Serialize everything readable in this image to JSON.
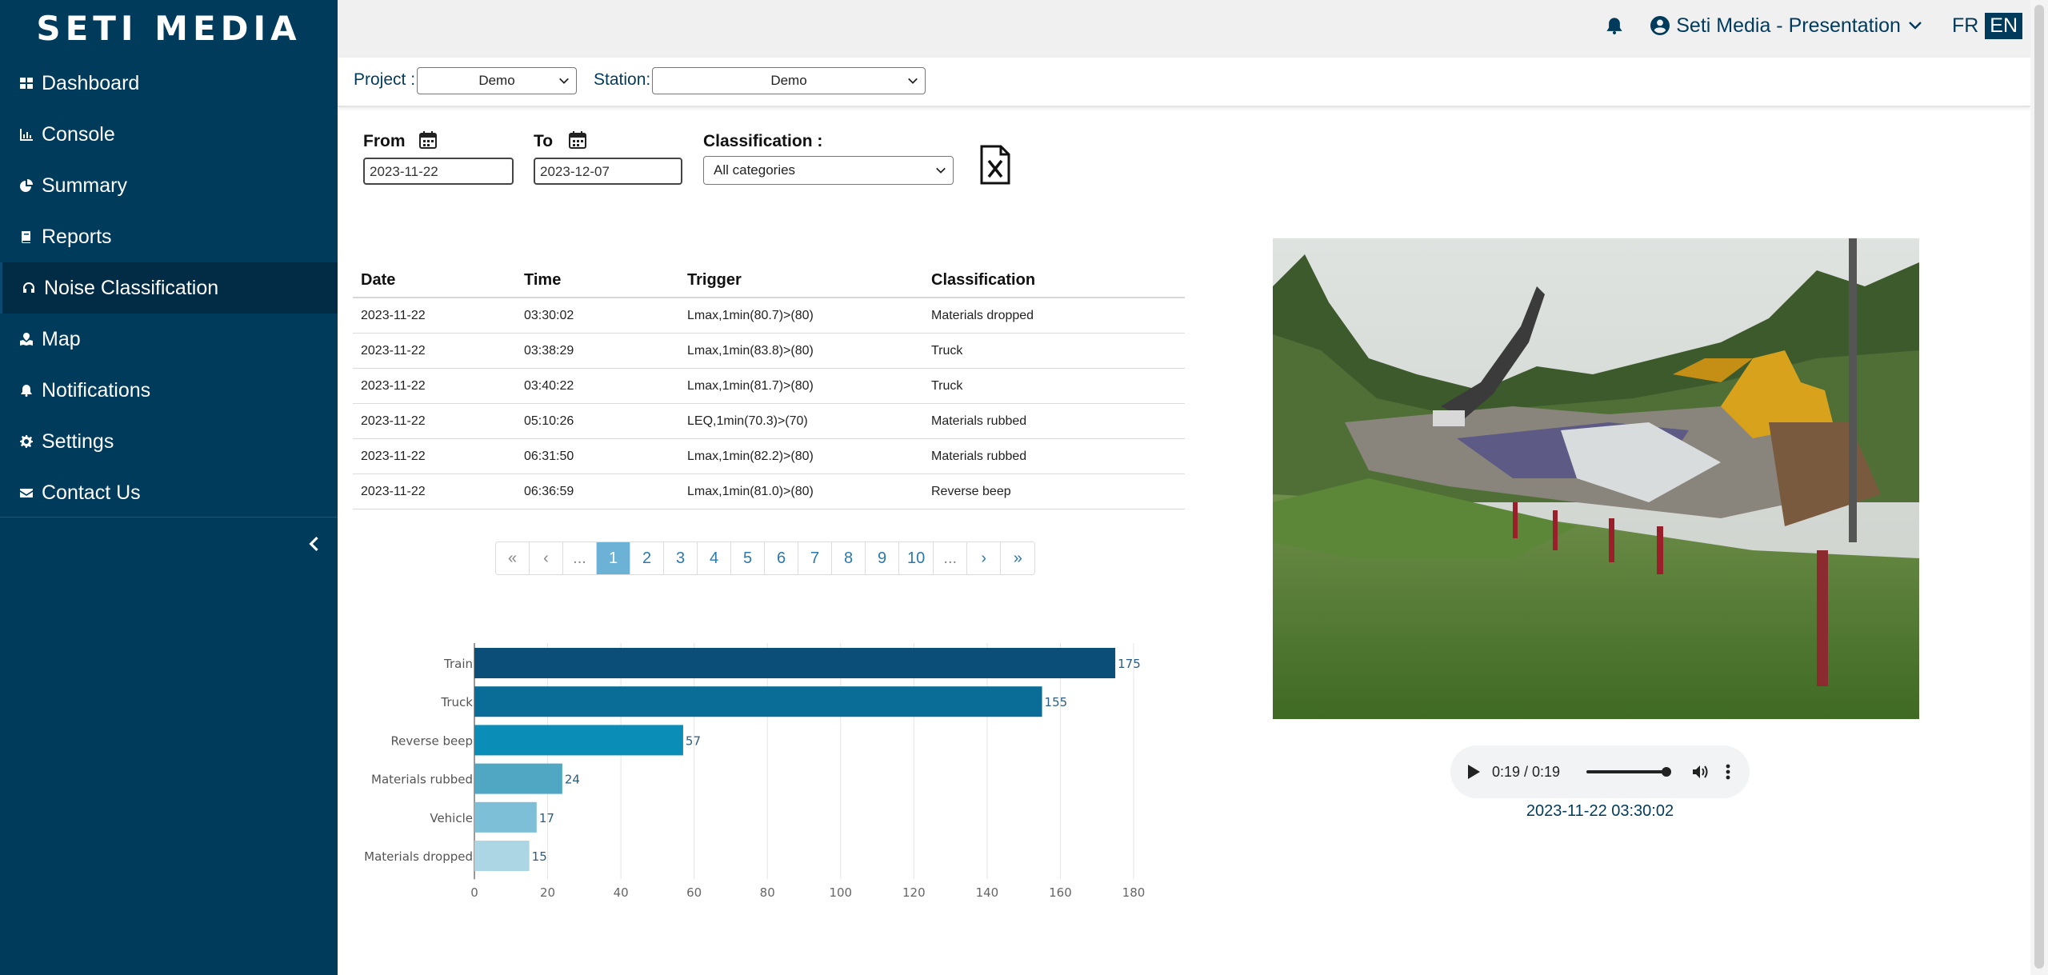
{
  "app": {
    "brand": "SETI MEDIA"
  },
  "sidebar": {
    "items": [
      {
        "label": "Dashboard",
        "icon": "dashboard-icon"
      },
      {
        "label": "Console",
        "icon": "chart-icon"
      },
      {
        "label": "Summary",
        "icon": "pie-icon"
      },
      {
        "label": "Reports",
        "icon": "book-icon"
      },
      {
        "label": "Noise Classification",
        "icon": "headphones-icon",
        "active": true
      },
      {
        "label": "Map",
        "icon": "map-icon"
      },
      {
        "label": "Notifications",
        "icon": "bell-icon"
      },
      {
        "label": "Settings",
        "icon": "gear-icon"
      },
      {
        "label": "Contact Us",
        "icon": "envelope-icon"
      }
    ]
  },
  "header": {
    "user": "Seti Media - Presentation",
    "lang_fr": "FR",
    "lang_en": "EN",
    "active_lang": "EN"
  },
  "filters": {
    "project_label": "Project :",
    "project_value": "Demo",
    "station_label": "Station:",
    "station_value": "Demo",
    "from_label": "From",
    "from_value": "2023-11-22",
    "to_label": "To",
    "to_value": "2023-12-07",
    "classification_label": "Classification :",
    "classification_value": "All categories"
  },
  "table": {
    "headers": [
      "Date",
      "Time",
      "Trigger",
      "Classification"
    ],
    "rows": [
      [
        "2023-11-22",
        "03:30:02",
        "Lmax,1min(80.7)>(80)",
        "Materials dropped"
      ],
      [
        "2023-11-22",
        "03:38:29",
        "Lmax,1min(83.8)>(80)",
        "Truck"
      ],
      [
        "2023-11-22",
        "03:40:22",
        "Lmax,1min(81.7)>(80)",
        "Truck"
      ],
      [
        "2023-11-22",
        "05:10:26",
        "LEQ,1min(70.3)>(70)",
        "Materials rubbed"
      ],
      [
        "2023-11-22",
        "06:31:50",
        "Lmax,1min(82.2)>(80)",
        "Materials rubbed"
      ],
      [
        "2023-11-22",
        "06:36:59",
        "Lmax,1min(81.0)>(80)",
        "Reverse beep"
      ]
    ]
  },
  "pagination": {
    "pages": [
      "«",
      "‹",
      "...",
      "1",
      "2",
      "3",
      "4",
      "5",
      "6",
      "7",
      "8",
      "9",
      "10",
      "...",
      "›",
      "»"
    ],
    "active": "1"
  },
  "chart_data": {
    "type": "bar",
    "orientation": "horizontal",
    "categories": [
      "Train",
      "Truck",
      "Reverse beep",
      "Materials rubbed",
      "Vehicle",
      "Materials dropped"
    ],
    "values": [
      175,
      155,
      57,
      24,
      17,
      15
    ],
    "xlim": [
      0,
      180
    ],
    "xticks": [
      0,
      20,
      40,
      60,
      80,
      100,
      120,
      140,
      160,
      180
    ],
    "grid": true,
    "colors": [
      "#0b4f79",
      "#0a6d97",
      "#0a8db6",
      "#4fa7c4",
      "#7cbfd6",
      "#acd6e4"
    ]
  },
  "media": {
    "audio_time": "0:19 / 0:19",
    "timestamp": "2023-11-22 03:30:02"
  }
}
